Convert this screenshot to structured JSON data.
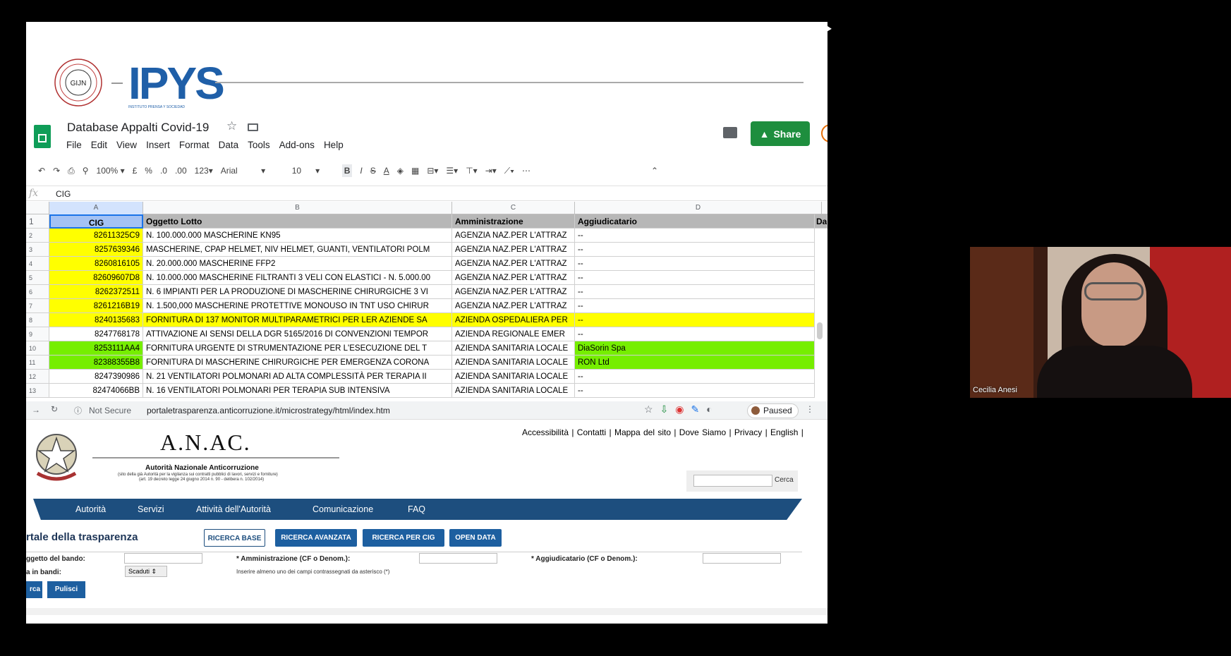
{
  "sheets": {
    "title": "Database Appalti Covid-19",
    "menu": [
      "File",
      "Edit",
      "View",
      "Insert",
      "Format",
      "Data",
      "Tools",
      "Add-ons",
      "Help"
    ],
    "share_label": "Share",
    "toolbar": {
      "zoom": "100%",
      "currency": "£",
      "percent": "%",
      "dec_less": ".0",
      "dec_more": ".00",
      "format": "123",
      "font": "Arial",
      "size": "10",
      "bold": "B",
      "italic": "I",
      "strike": "S",
      "text_color": "A"
    },
    "formula_value": "CIG",
    "columns": [
      "A",
      "B",
      "C",
      "D"
    ],
    "headers": {
      "row": "1",
      "a": "CIG",
      "b": "Oggetto Lotto",
      "c": "Amministrazione",
      "d": "Aggiudicatario",
      "e": "Da"
    },
    "rows": [
      {
        "n": "2",
        "a": "82611325C9",
        "b": "N. 100.000.000 MASCHERINE KN95",
        "c": "AGENZIA NAZ.PER L'ATTRAZ",
        "d": "--",
        "style": "a-yellow"
      },
      {
        "n": "3",
        "a": "8257639346",
        "b": "MASCHERINE, CPAP HELMET, NIV HELMET, GUANTI, VENTILATORI POLM",
        "c": "AGENZIA NAZ.PER L'ATTRAZ",
        "d": "--",
        "style": "a-yellow"
      },
      {
        "n": "4",
        "a": "8260816105",
        "b": "N. 20.000.000 MASCHERINE FFP2",
        "c": "AGENZIA NAZ.PER L'ATTRAZ",
        "d": "--",
        "style": "a-yellow"
      },
      {
        "n": "5",
        "a": "82609607D8",
        "b": "N. 10.000.000 MASCHERINE FILTRANTI 3 VELI CON ELASTICI - N. 5.000.00",
        "c": "AGENZIA NAZ.PER L'ATTRAZ",
        "d": "--",
        "style": "a-yellow"
      },
      {
        "n": "6",
        "a": "8262372511",
        "b": "N. 6 IMPIANTI PER LA PRODUZIONE DI MASCHERINE CHIRURGICHE 3 VI",
        "c": "AGENZIA NAZ.PER L'ATTRAZ",
        "d": "--",
        "style": "a-yellow"
      },
      {
        "n": "7",
        "a": "8261216B19",
        "b": "N. 1.500,000 MASCHERINE PROTETTIVE MONOUSO IN TNT USO CHIRUR",
        "c": "AGENZIA NAZ.PER L'ATTRAZ",
        "d": "--",
        "style": "a-yellow"
      },
      {
        "n": "8",
        "a": "8240135683",
        "b": "FORNITURA DI 137 MONITOR MULTIPARAMETRICI PER LER AZIENDE SA",
        "c": "AZIENDA OSPEDALIERA PER",
        "d": "--",
        "style": "all-yellow"
      },
      {
        "n": "9",
        "a": "8247768178",
        "b": "ATTIVAZIONE AI SENSI DELLA DGR 5165/2016 DI CONVENZIONI TEMPOR",
        "c": "AZIENDA REGIONALE EMER",
        "d": "--",
        "style": "none"
      },
      {
        "n": "10",
        "a": "8253111AA4",
        "b": "FORNITURA URGENTE DI STRUMENTAZIONE PER L'ESECUZIONE DEL T",
        "c": "AZIENDA SANITARIA LOCALE",
        "d": "DiaSorin Spa",
        "style": "ad-green"
      },
      {
        "n": "11",
        "a": "82388355B8",
        "b": "FORNITURA DI MASCHERINE CHIRURGICHE PER EMERGENZA CORONA",
        "c": "AZIENDA SANITARIA LOCALE",
        "d": "RON Ltd",
        "style": "ad-green"
      },
      {
        "n": "12",
        "a": "8247390986",
        "b": "N. 21 VENTILATORI POLMONARI AD ALTA COMPLESSITÀ PER TERAPIA II",
        "c": "AZIENDA SANITARIA LOCALE",
        "d": "--",
        "style": "none"
      },
      {
        "n": "13",
        "a": "82474066BB",
        "b": "N. 16 VENTILATORI POLMONARI PER TERAPIA SUB INTENSIVA",
        "c": "AZIENDA SANITARIA LOCALE",
        "d": "--",
        "style": "none"
      }
    ]
  },
  "logos": {
    "gijn": "GIJN",
    "ipys": "IPYS",
    "ipys_sub": "INSTITUTO PRENSA Y SOCIEDAD"
  },
  "browser": {
    "not_secure": "Not Secure",
    "url": "portaletrasparenza.anticorruzione.it/microstrategy/html/index.htm",
    "paused": "Paused"
  },
  "anac": {
    "links": "Accessibilità | Contatti | Mappa del sito | Dove Siamo | Privacy | English |",
    "title": "A.N.AC.",
    "subtitle": "Autorità Nazionale Anticorruzione",
    "small1": "(sito della già Autorità per la vigilanza sui contratti pubblici di lavori, servizi e forniture)",
    "small2": "(art. 19 decreto legge 24 giugno 2014 n. 90 - delibera n. 102/2014)",
    "search_btn": "Cerca",
    "nav": [
      "Autorità",
      "Servizi",
      "Attività dell'Autorità",
      "Comunicazione",
      "FAQ"
    ],
    "portal_title": "rtale della trasparenza",
    "buttons": [
      "RICERCA BASE",
      "RICERCA AVANZATA",
      "RICERCA PER CIG",
      "OPEN DATA"
    ],
    "lbl_oggetto": "ggetto del bando:",
    "lbl_amm": "* Amministrazione (CF o Denom.):",
    "lbl_agg": "* Aggiudicatario (CF o Denom.):",
    "lbl_cerca_in": "a in bandi:",
    "select_value": "Scaduti",
    "hint": "Inserire almeno uno dei campi contrassegnati da asterisco (*)",
    "cerca": "rca",
    "pulisci": "Pulisci"
  },
  "webcam": {
    "name": "Cecilia Anesi"
  }
}
